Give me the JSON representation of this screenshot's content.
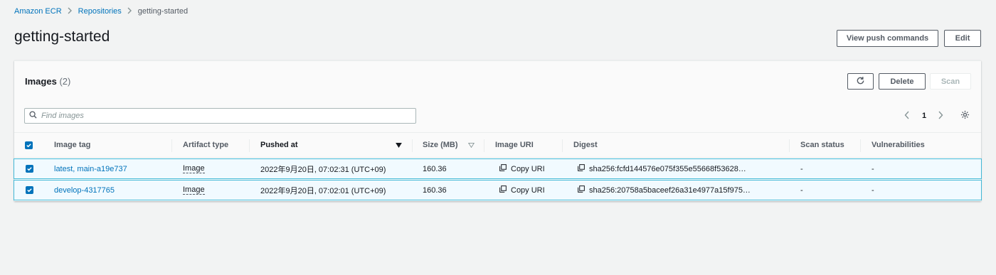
{
  "breadcrumb": {
    "items": [
      "Amazon ECR",
      "Repositories"
    ],
    "current": "getting-started"
  },
  "page": {
    "title": "getting-started"
  },
  "actions": {
    "view_push_commands": "View push commands",
    "edit": "Edit"
  },
  "images_panel": {
    "title": "Images",
    "count": "(2)",
    "delete": "Delete",
    "scan": "Scan",
    "search_placeholder": "Find images",
    "page_number": "1"
  },
  "table": {
    "columns": {
      "image_tag": "Image tag",
      "artifact_type": "Artifact type",
      "pushed_at": "Pushed at",
      "size": "Size (MB)",
      "image_uri": "Image URI",
      "digest": "Digest",
      "scan_status": "Scan status",
      "vulnerabilities": "Vulnerabilities"
    },
    "rows": [
      {
        "image_tag": "latest, main-a19e737",
        "artifact_type": "Image",
        "pushed_at": "2022年9月20日, 07:02:31 (UTC+09)",
        "size": "160.36",
        "image_uri": "Copy URI",
        "digest": "sha256:fcfd144576e075f355e55668f53628…",
        "scan_status": "-",
        "vulnerabilities": "-"
      },
      {
        "image_tag": "develop-4317765",
        "artifact_type": "Image",
        "pushed_at": "2022年9月20日, 07:02:01 (UTC+09)",
        "size": "160.36",
        "image_uri": "Copy URI",
        "digest": "sha256:20758a5baceef26a31e4977a15f975…",
        "scan_status": "-",
        "vulnerabilities": "-"
      }
    ]
  },
  "colors": {
    "link": "#0073bb",
    "selected_row_bg": "#f1faff",
    "selected_row_border": "#44b9d6",
    "page_bg": "#f2f3f3"
  },
  "icons": [
    "chevron-right-icon",
    "refresh-icon",
    "search-icon",
    "chevron-left-icon",
    "gear-icon",
    "sort-desc-icon",
    "sort-icon",
    "copy-icon",
    "checkbox-checked-icon"
  ]
}
